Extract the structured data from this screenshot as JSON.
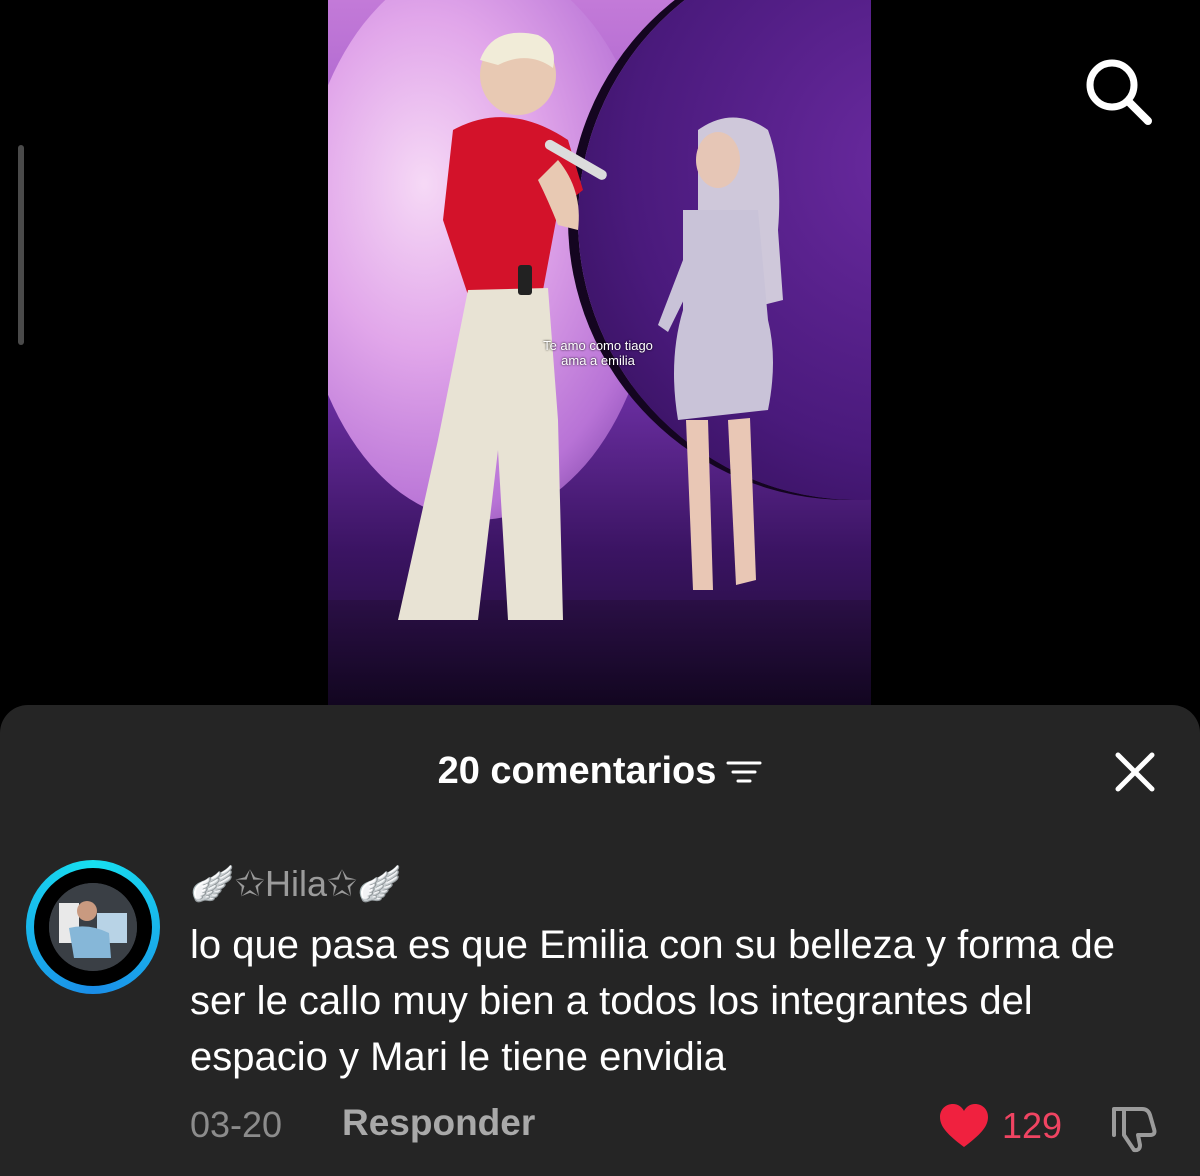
{
  "video": {
    "caption_line1": "Te amo como tiago",
    "caption_line2": "ama a emilia"
  },
  "header": {
    "search_icon": "search-icon"
  },
  "comments_sheet": {
    "title": "20 comentarios",
    "filter_icon": "filter-icon",
    "close_icon": "close-icon",
    "comment": {
      "username": "🪽✩Hila✩🪽",
      "text": "lo que pasa es que Emilia con su belleza y forma de ser le callo muy bien a todos los integrantes del espacio y Mari le tiene envidia",
      "date": "03-20",
      "reply_label": "Responder",
      "like_count": "129",
      "like_icon": "heart-icon",
      "dislike_icon": "thumbs-down-icon"
    }
  },
  "colors": {
    "sheet_bg": "#252525",
    "like_color": "#f04462",
    "avatar_ring": "#17e0f0"
  }
}
